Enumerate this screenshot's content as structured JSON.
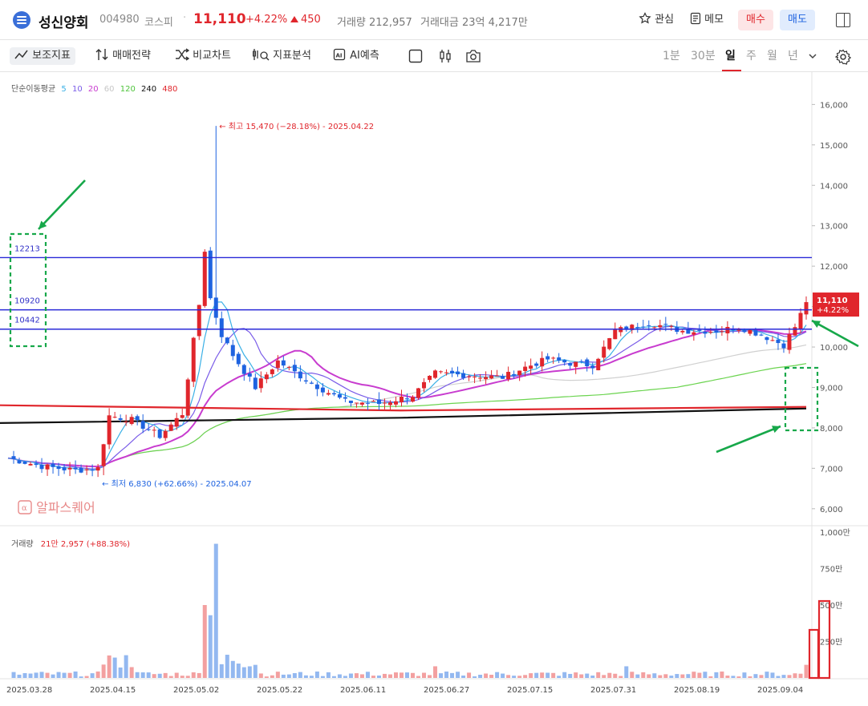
{
  "header": {
    "name": "성신양회",
    "code": "004980",
    "market": "코스피",
    "price": "11,110",
    "change_pct": "+4.22%",
    "change_val": "450",
    "volume": "거래량 212,957",
    "amount": "거래대금 23억 4,217만",
    "fav_label": "관심",
    "memo_label": "메모",
    "buy_label": "매수",
    "sell_label": "매도"
  },
  "toolbar": {
    "indicators": "보조지표",
    "strategy": "매매전략",
    "compare": "비교차트",
    "analysis": "지표분석",
    "ai": "AI예측",
    "periods": [
      "1분",
      "30분",
      "일",
      "주",
      "월",
      "년"
    ],
    "selected_period": "일"
  },
  "ma_legend": {
    "title": "단순이동평균",
    "items": [
      {
        "label": "5",
        "color": "#3ab0e6"
      },
      {
        "label": "10",
        "color": "#7a5ce8"
      },
      {
        "label": "20",
        "color": "#c83ccf"
      },
      {
        "label": "60",
        "color": "#c7c7c7"
      },
      {
        "label": "120",
        "color": "#4fc43c"
      },
      {
        "label": "240",
        "color": "#111111"
      },
      {
        "label": "480",
        "color": "#e0262c"
      }
    ]
  },
  "watermark": "알파스퀘어",
  "volume_label": {
    "title": "거래량",
    "value": "21만 2,957 (+88.38%)"
  },
  "chart_data": {
    "type": "candlestick",
    "y_range": [
      5600,
      16800
    ],
    "y_ticks": [
      "16,000",
      "15,000",
      "14,000",
      "13,000",
      "12,000",
      "11,000",
      "10,000",
      "9,000",
      "8,000",
      "7,000",
      "6,000"
    ],
    "y_tick_values": [
      16000,
      15000,
      14000,
      13000,
      12000,
      11000,
      10000,
      9000,
      8000,
      7000,
      6000
    ],
    "x_ticks": [
      "2025.03.28",
      "2025.04.15",
      "2025.05.02",
      "2025.05.22",
      "2025.06.11",
      "2025.06.27",
      "2025.07.15",
      "2025.07.31",
      "2025.08.19",
      "2025.09.04"
    ],
    "horizontal_lines": [
      {
        "value": 12213,
        "label": "12213"
      },
      {
        "value": 10920,
        "label": "10920"
      },
      {
        "value": 10442,
        "label": "10442"
      }
    ],
    "high_annotation": "최고 15,470 (−28.18%) - 2025.04.22",
    "low_annotation": "최저 6,830 (+62.66%) - 2025.04.07",
    "last_price_label": "11,110",
    "last_price_pct": "+4.22%",
    "last_price": 11110,
    "up_color": "#e0262c",
    "down_color": "#1e63e0",
    "volume_ticks": [
      "1,000만",
      "750만",
      "500만",
      "250만"
    ],
    "volume_tick_values": [
      1000,
      750,
      500,
      250
    ],
    "volume_range": [
      0,
      1000
    ]
  }
}
